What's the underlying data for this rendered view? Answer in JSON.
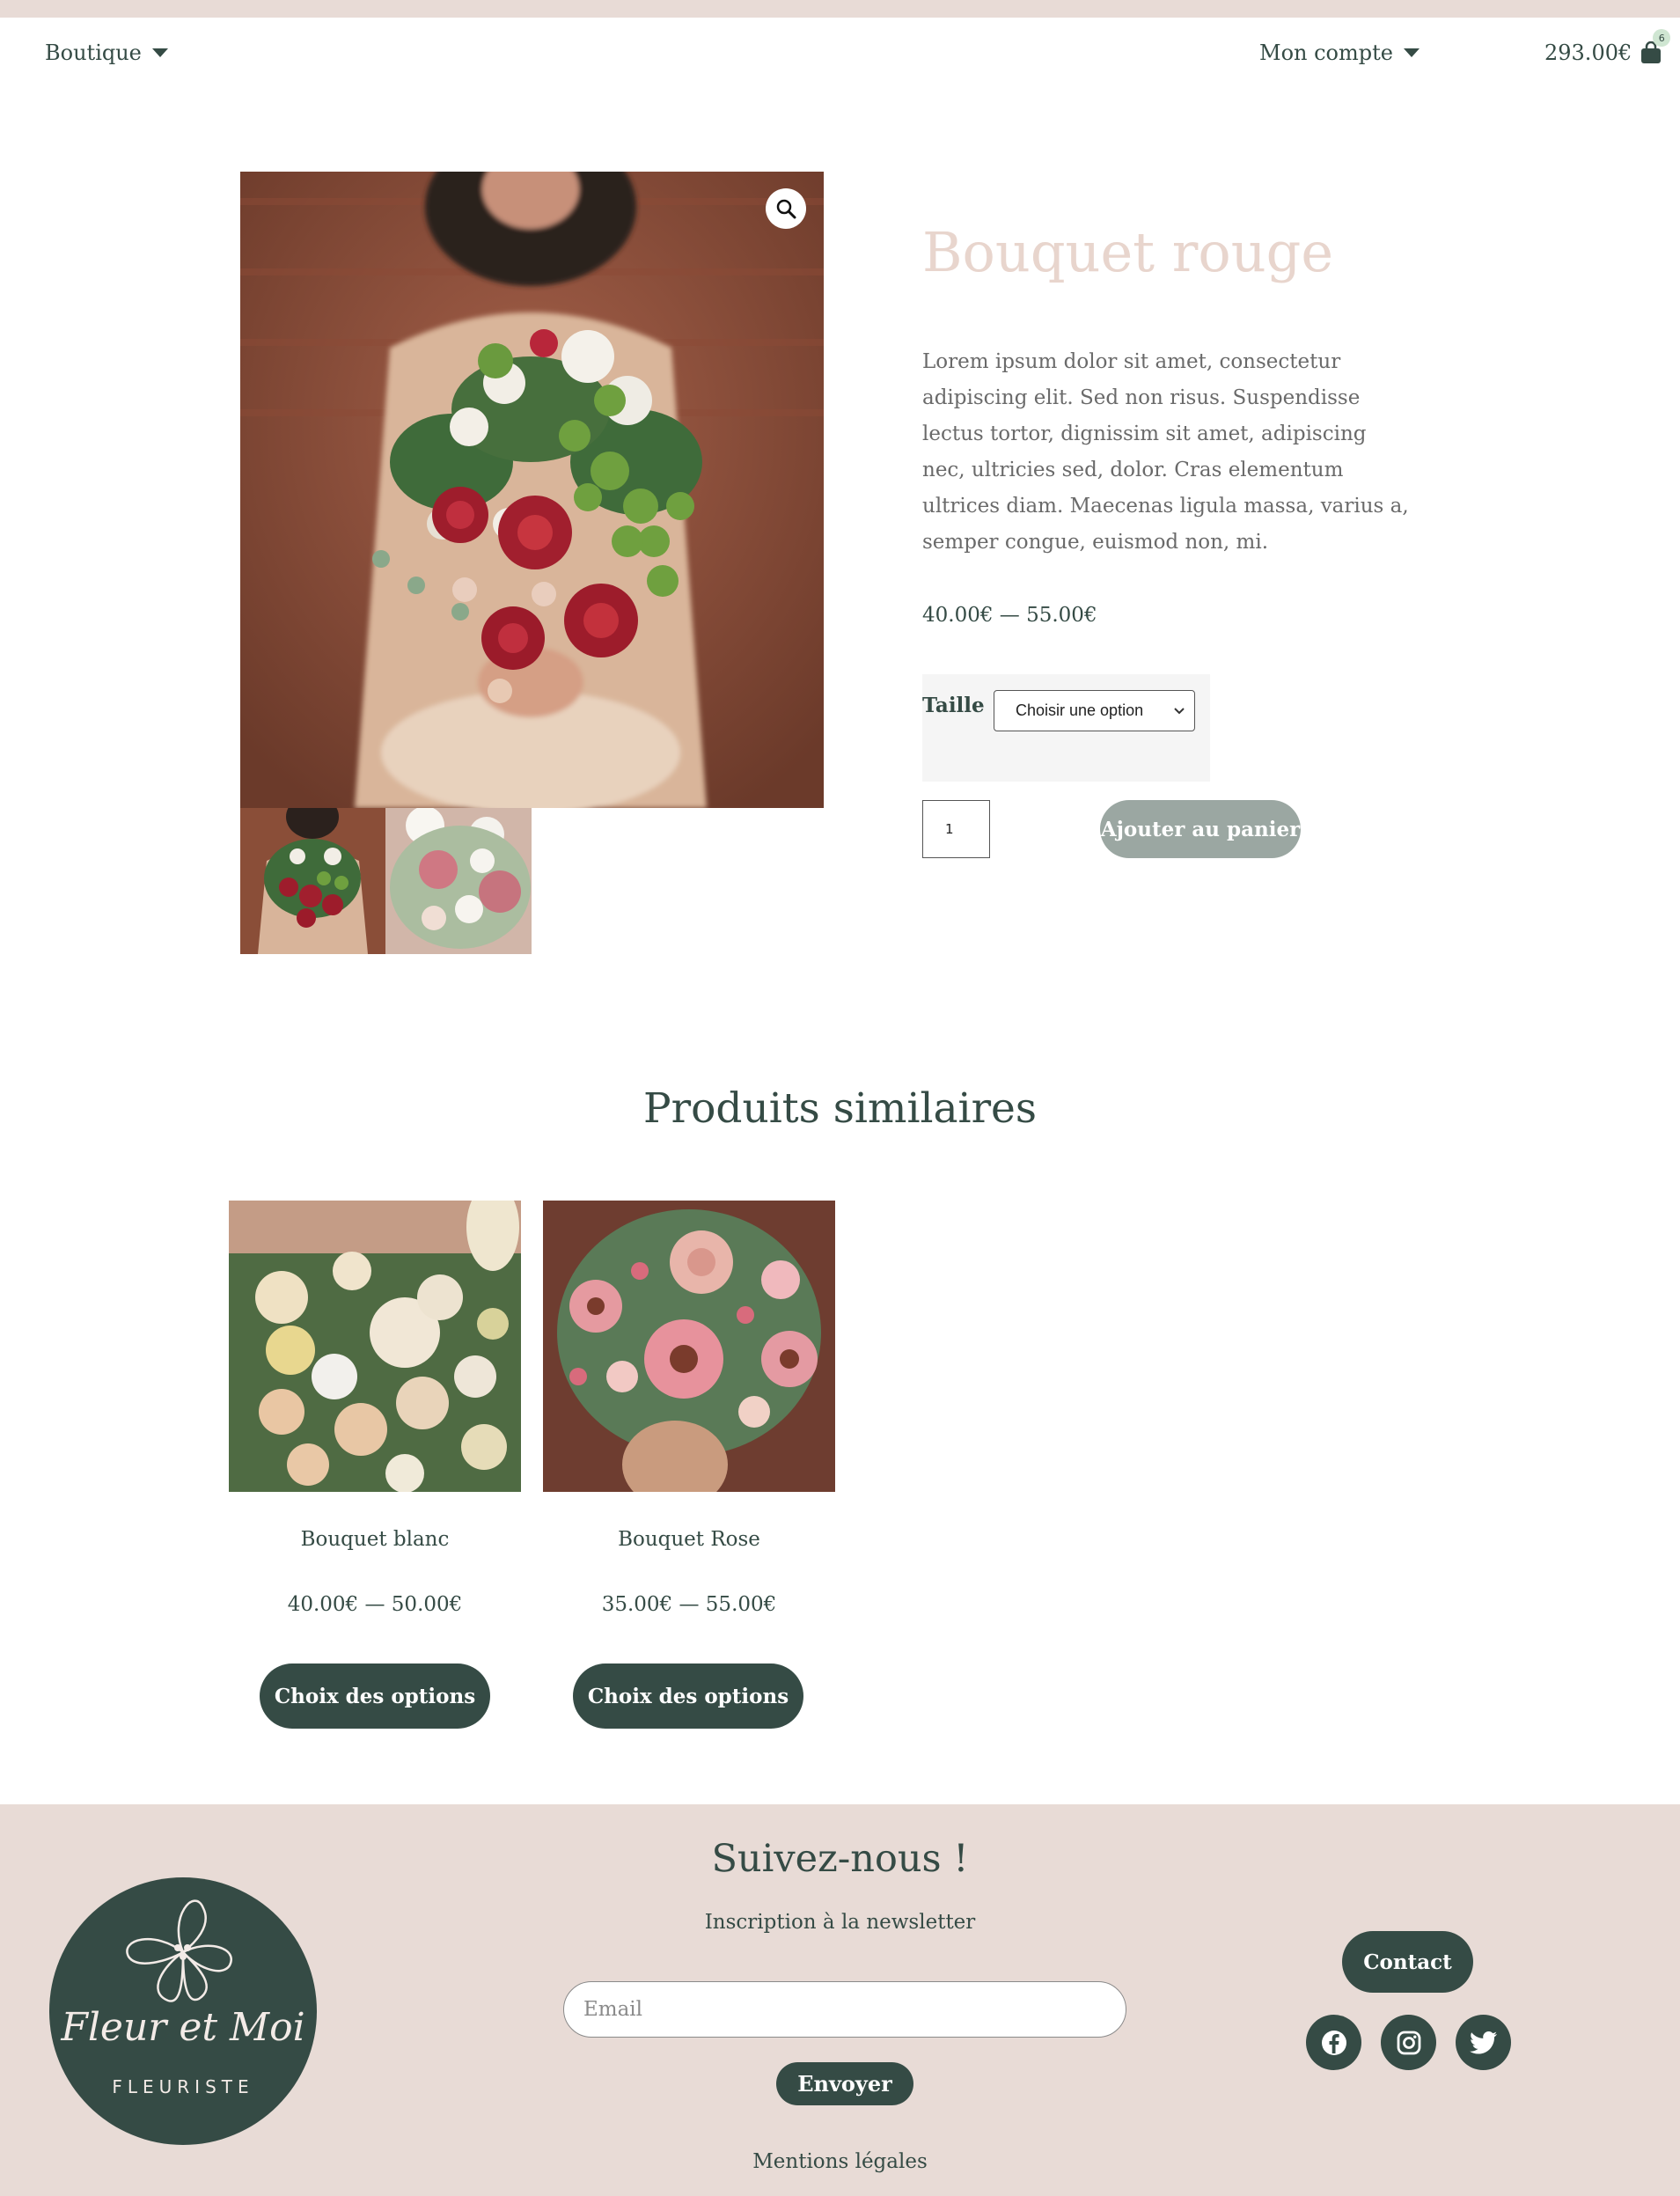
{
  "header": {
    "shop_label": "Boutique",
    "account_label": "Mon compte",
    "cart_total": "293.00€",
    "cart_count": "6"
  },
  "product": {
    "title": "Bouquet rouge",
    "description": "Lorem ipsum dolor sit amet, consectetur adipiscing elit. Sed non risus. Suspendisse lectus tortor, dignissim sit amet, adipiscing nec, ultricies sed, dolor. Cras elementum ultrices diam. Maecenas ligula massa, varius a, semper congue, euismod non, mi.",
    "price": "40.00€ — 55.00€",
    "variation_label": "Taille",
    "variation_selected": "Choisir une option",
    "quantity": "1",
    "add_to_cart_label": "Ajouter au panier"
  },
  "related": {
    "heading": "Produits similaires",
    "items": [
      {
        "title": "Bouquet blanc",
        "price": "40.00€ — 50.00€",
        "button": "Choix des options"
      },
      {
        "title": "Bouquet Rose",
        "price": "35.00€ — 55.00€",
        "button": "Choix des options"
      }
    ]
  },
  "footer": {
    "logo_script": "Fleur et Moi",
    "logo_sub": "FLEURISTE",
    "title": "Suivez-nous !",
    "newsletter_label": "Inscription à la newsletter",
    "email_placeholder": "Email",
    "send_label": "Envoyer",
    "legal_label": "Mentions légales",
    "contact_label": "Contact",
    "social_icons": [
      "facebook-icon",
      "instagram-icon",
      "twitter-icon"
    ]
  },
  "colors": {
    "brand_dark": "#354b45",
    "brand_pink": "#e8dbd6",
    "title_pink": "#e8d5cd",
    "button_disabled": "#9ba7a2"
  }
}
